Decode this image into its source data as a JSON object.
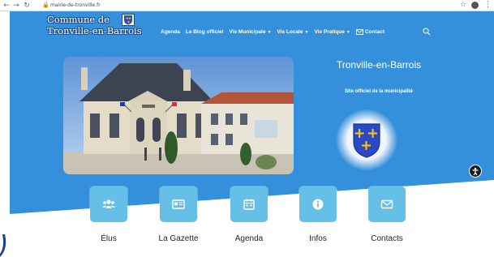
{
  "browser": {
    "url": "mairie-de-tronville.fr"
  },
  "site": {
    "brand_line1": "Commune de",
    "brand_line2": "Tronville-en-Barrois",
    "menu": [
      {
        "label": "Agenda",
        "has_dropdown": false
      },
      {
        "label": "Le Blog officiel",
        "has_dropdown": false
      },
      {
        "label": "Vie Municipale",
        "has_dropdown": true
      },
      {
        "label": "Vie Locale",
        "has_dropdown": true
      },
      {
        "label": "Vie Pratique",
        "has_dropdown": true
      },
      {
        "label": "Contact",
        "has_dropdown": false,
        "icon": "envelope-icon"
      }
    ],
    "hero_title": "Tronville-en-Barrois",
    "hero_subtitle": "Site officiel de la municipalité",
    "quick_links": [
      {
        "label": "Élus",
        "icon": "users-icon"
      },
      {
        "label": "La Gazette",
        "icon": "newspaper-icon"
      },
      {
        "label": "Agenda",
        "icon": "calendar-icon"
      },
      {
        "label": "Infos",
        "icon": "info-icon"
      },
      {
        "label": "Contacts",
        "icon": "envelope-icon"
      }
    ]
  },
  "colors": {
    "hero_blue": "#3590db",
    "tile_blue": "#66bfe6",
    "shield_blue": "#2a49c8",
    "cross_gold": "#f2c21b"
  }
}
